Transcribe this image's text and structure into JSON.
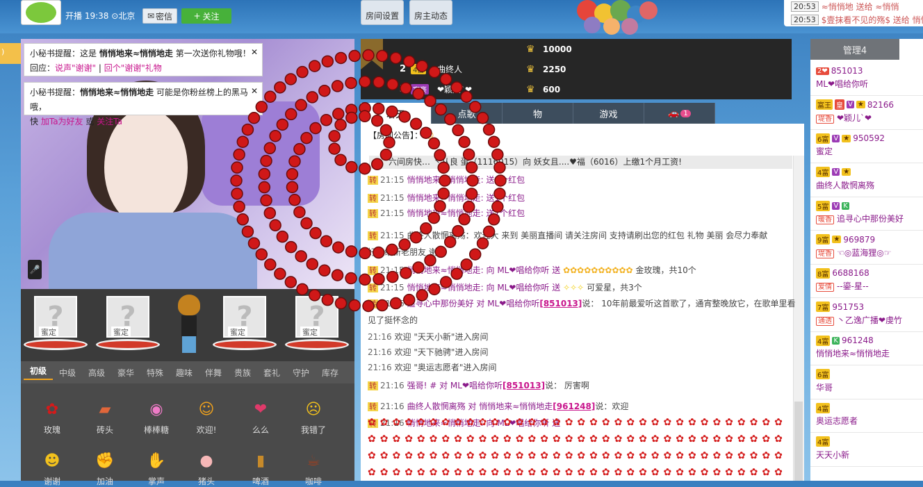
{
  "header": {
    "onair_label": "开播",
    "onair_time": "19:38",
    "location": "北京",
    "pm_label": "密信",
    "follow_label": "关注",
    "room_settings": "房间设置",
    "host_activity": "房主动态"
  },
  "notices": [
    {
      "time": "20:53",
      "text": "≈悄悄地 送给 ≈悄悄"
    },
    {
      "time": "20:53",
      "text": "$壹抹看不见的殇$ 送给 悄悄"
    }
  ],
  "tips": [
    {
      "prefix": "小秘书提醒：这是",
      "name": "悄悄地来≈悄悄地走",
      "suffix": "第一次送你礼物哦！",
      "line2_prefix": "回应：",
      "link1": "说声\"谢谢\"",
      "sep": "|",
      "link2": "回个\"谢谢\"礼物"
    },
    {
      "prefix": "小秘书提醒：",
      "name": "悄悄地来≈悄悄地走",
      "suffix": "可能是你粉丝榜上的黑马哦，",
      "line2_prefix": "快",
      "link1": "加Ta为好友",
      "or": "或",
      "link2": "关注Ta"
    }
  ],
  "seats": [
    {
      "label": "蜜定"
    },
    {
      "label": "蜜定"
    },
    {
      "label": "蜜定"
    },
    {
      "label": "蜜定"
    }
  ],
  "gift_tabs": [
    "初级",
    "中级",
    "高级",
    "豪华",
    "特殊",
    "趣味",
    "伴舞",
    "贵族",
    "套礼",
    "守护",
    "库存"
  ],
  "gifts": [
    {
      "name": "玫瑰",
      "icon": "rose-icon"
    },
    {
      "name": "砖头",
      "icon": "brick-icon"
    },
    {
      "name": "棒棒糖",
      "icon": "lollipop-icon"
    },
    {
      "name": "欢迎!",
      "icon": "welcome-icon"
    },
    {
      "name": "么么",
      "icon": "kiss-icon"
    },
    {
      "name": "我错了",
      "icon": "sorry-icon"
    },
    {
      "name": "谢谢",
      "icon": "thanks-icon"
    },
    {
      "name": "加油",
      "icon": "cheer-icon"
    },
    {
      "name": "掌声",
      "icon": "clap-icon"
    },
    {
      "name": "猪头",
      "icon": "pig-icon"
    },
    {
      "name": "啤酒",
      "icon": "beer-icon"
    },
    {
      "name": "咖啡",
      "icon": "coffee-icon"
    }
  ],
  "rank": [
    {
      "num": "",
      "level": "",
      "name": "",
      "value": "10000"
    },
    {
      "num": "2",
      "level": "4富",
      "name": "曲终人",
      "value": "2250"
    },
    {
      "num": "3",
      "level": "富豪",
      "name": "❤颖儿`❤",
      "value": "600"
    }
  ],
  "chat_tabs": [
    {
      "label": "聊天"
    },
    {
      "label": "点歌"
    },
    {
      "label": "物"
    },
    {
      "label": "游戏"
    },
    {
      "label": "",
      "badge": "1"
    }
  ],
  "chat": {
    "announce": "【房间公告】：",
    "system": "六间房快… 丶从良 蛋（1116015）向 妖女且....♥福（6016）上缴1个月工资!",
    "rows": [
      {
        "zhuan": "转",
        "time": "21:15",
        "text": "悄悄地来≈悄悄地走: 送1个红包"
      },
      {
        "zhuan": "转",
        "time": "21:15",
        "text": "悄悄地来≈悄悄地走: 送1个红包"
      },
      {
        "zhuan": "转",
        "time": "21:15",
        "text": "悄悄地来≈悄悄地走: 送1个红包"
      },
      {
        "zhuan": "转",
        "time": "21:15",
        "text": "曲终人散惘离殇：欢迎大 来到 美丽直播间 请关注房间 支持请刷出您的红包 礼物 美丽 会尽力奉献"
      },
      {
        "zhuan": "",
        "time": "",
        "text": "好歌给新老朋友 谢谢"
      },
      {
        "zhuan": "转",
        "time": "21:15",
        "text": "悄悄地来≈悄悄地走: 向 ML❤唱给你听 送",
        "tail": "金玫瑰，共10个"
      },
      {
        "zhuan": "转",
        "time": "21:15",
        "text": "悄悄地来≈悄悄地走: 向 ML❤唱给你听 送",
        "tail": "可爱星，共3个"
      },
      {
        "zhuan": "转",
        "time": "21:16",
        "text": "追寻心中那份美好 对 ML❤唱给你听",
        "link": "[851013]",
        "tail": "说： 10年前最爱听这首歌了，通宵整晚放它，在歌单里看"
      },
      {
        "zhuan": "",
        "time": "",
        "text": "见了挺怀念的"
      },
      {
        "zhuan": "",
        "time": "21:16",
        "text": "欢迎 \"天天小新\"进入房间"
      },
      {
        "zhuan": "",
        "time": "21:16",
        "text": "欢迎 \"天下驰骋\"进入房间"
      },
      {
        "zhuan": "",
        "time": "21:16",
        "text": "欢迎 \"奥运志愿者\"进入房间"
      },
      {
        "zhuan": "转",
        "time": "21:16",
        "text": "强哥! # 对 ML❤唱给你听",
        "link": "[851013]",
        "tail": "说： 厉害啊"
      },
      {
        "zhuan": "转",
        "time": "21:16",
        "text": "曲终人散惘离殇 对 悄悄地来≈悄悄地走",
        "link": "[961248]",
        "tail": "说：欢迎"
      },
      {
        "zhuan": "转",
        "time": "21:16",
        "text": "悄悄地来≈悄悄地走: 向 ML❤唱给你听 送"
      }
    ]
  },
  "right_panel": {
    "tab": "管理4",
    "users": [
      {
        "tags": [
          "2❤"
        ],
        "id": "851013",
        "name": "ML❤唱给你听"
      },
      {
        "tags": [
          "富王",
          "皇",
          "V",
          "★"
        ],
        "id": "82166",
        "extra": "堤香",
        "name": "❤颖儿`❤"
      },
      {
        "tags": [
          "6富",
          "V",
          "★"
        ],
        "id": "950592",
        "name": "蜜定"
      },
      {
        "tags": [
          "4富",
          "V",
          "★"
        ],
        "id": "",
        "name": "曲终人散惘离殇"
      },
      {
        "tags": [
          "5富",
          "V",
          "K"
        ],
        "id": "",
        "extra": "暖香",
        "name": "追寻心中那份美好"
      },
      {
        "tags": [
          "9富",
          "★"
        ],
        "id": "969879",
        "extra": "堤香",
        "name": "☜◎蓝海狸◎☞"
      },
      {
        "tags": [
          "8富"
        ],
        "id": "6688168",
        "extra": "爱情",
        "name": "--鎏-星--"
      },
      {
        "tags": [
          "7富"
        ],
        "id": "951753",
        "extra": "通透",
        "name": "丶乙逸广播❤虔竹"
      },
      {
        "tags": [
          "4富",
          "K"
        ],
        "id": "961248",
        "name": "悄悄地来≈悄悄地走"
      },
      {
        "tags": [
          "6富"
        ],
        "id": "",
        "name": "华哥"
      },
      {
        "tags": [
          "4富"
        ],
        "id": "",
        "name": "奥运志愿者"
      },
      {
        "tags": [
          "4富"
        ],
        "id": "",
        "name": "天天小新"
      }
    ]
  },
  "colors": {
    "accent": "#c8148c",
    "header": "#2d74b8",
    "dark": "#262626"
  }
}
